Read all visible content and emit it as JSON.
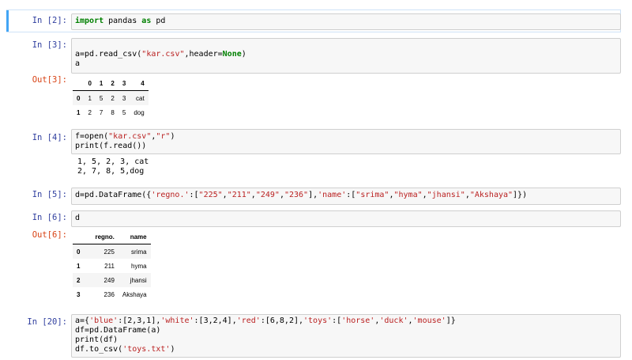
{
  "cells": {
    "c2": {
      "prompt": "In [2]:",
      "kw1": "import",
      "t1": " pandas ",
      "kw2": "as",
      "t2": " pd"
    },
    "c3": {
      "prompt": "In [3]:",
      "l1a": "a=pd.read_csv(",
      "l1s": "\"kar.csv\"",
      "l1b": ",header=",
      "l1c": "None",
      "l1d": ")",
      "l2": "a",
      "out_prompt": "Out[3]:",
      "table": {
        "columns": [
          "",
          "0",
          "1",
          "2",
          "3",
          "4"
        ],
        "rows": [
          [
            "0",
            "1",
            "5",
            "2",
            "3",
            "cat"
          ],
          [
            "1",
            "2",
            "7",
            "8",
            "5",
            "dog"
          ]
        ]
      }
    },
    "c4": {
      "prompt": "In [4]:",
      "l1a": "f=open(",
      "l1s1": "\"kar.csv\"",
      "l1b": ",",
      "l1s2": "\"r\"",
      "l1c": ")",
      "l2": "print(f.read())",
      "stream1": "1, 5, 2, 3, cat",
      "stream2": "2, 7, 8, 5,dog"
    },
    "c5": {
      "prompt": "In [5]:",
      "p1": "d=pd.DataFrame({",
      "s1": "'regno.'",
      "p2": ":[",
      "s2": "\"225\"",
      "p3": ",",
      "s3": "\"211\"",
      "p4": ",",
      "s4": "\"249\"",
      "p5": ",",
      "s5": "\"236\"",
      "p6": "],",
      "s6": "'name'",
      "p7": ":[",
      "s7": "\"srima\"",
      "p8": ",",
      "s8": "\"hyma\"",
      "p9": ",",
      "s9": "\"jhansi\"",
      "p10": ",",
      "s10": "\"Akshaya\"",
      "p11": "]})"
    },
    "c6": {
      "prompt": "In [6]:",
      "code": "d",
      "out_prompt": "Out[6]:",
      "table": {
        "columns": [
          "",
          "regno.",
          "name"
        ],
        "rows": [
          [
            "0",
            "225",
            "srima"
          ],
          [
            "1",
            "211",
            "hyma"
          ],
          [
            "2",
            "249",
            "jhansi"
          ],
          [
            "3",
            "236",
            "Akshaya"
          ]
        ]
      }
    },
    "c20": {
      "prompt": "In [20]:",
      "a1": "a={",
      "a2": "'blue'",
      "a3": ":[2,3,1],",
      "a4": "'white'",
      "a5": ":[3,2,4],",
      "a6": "'red'",
      "a7": ":[6,8,2],",
      "a8": "'toys'",
      "a9": ":[",
      "a10": "'horse'",
      "a11": ",",
      "a12": "'duck'",
      "a13": ",",
      "a14": "'mouse'",
      "a15": "]}",
      "l2": "df=pd.DataFrame(a)",
      "l3": "print(df)",
      "l4a": "df.to_csv(",
      "l4s": "'toys.txt'",
      "l4b": ")"
    }
  }
}
